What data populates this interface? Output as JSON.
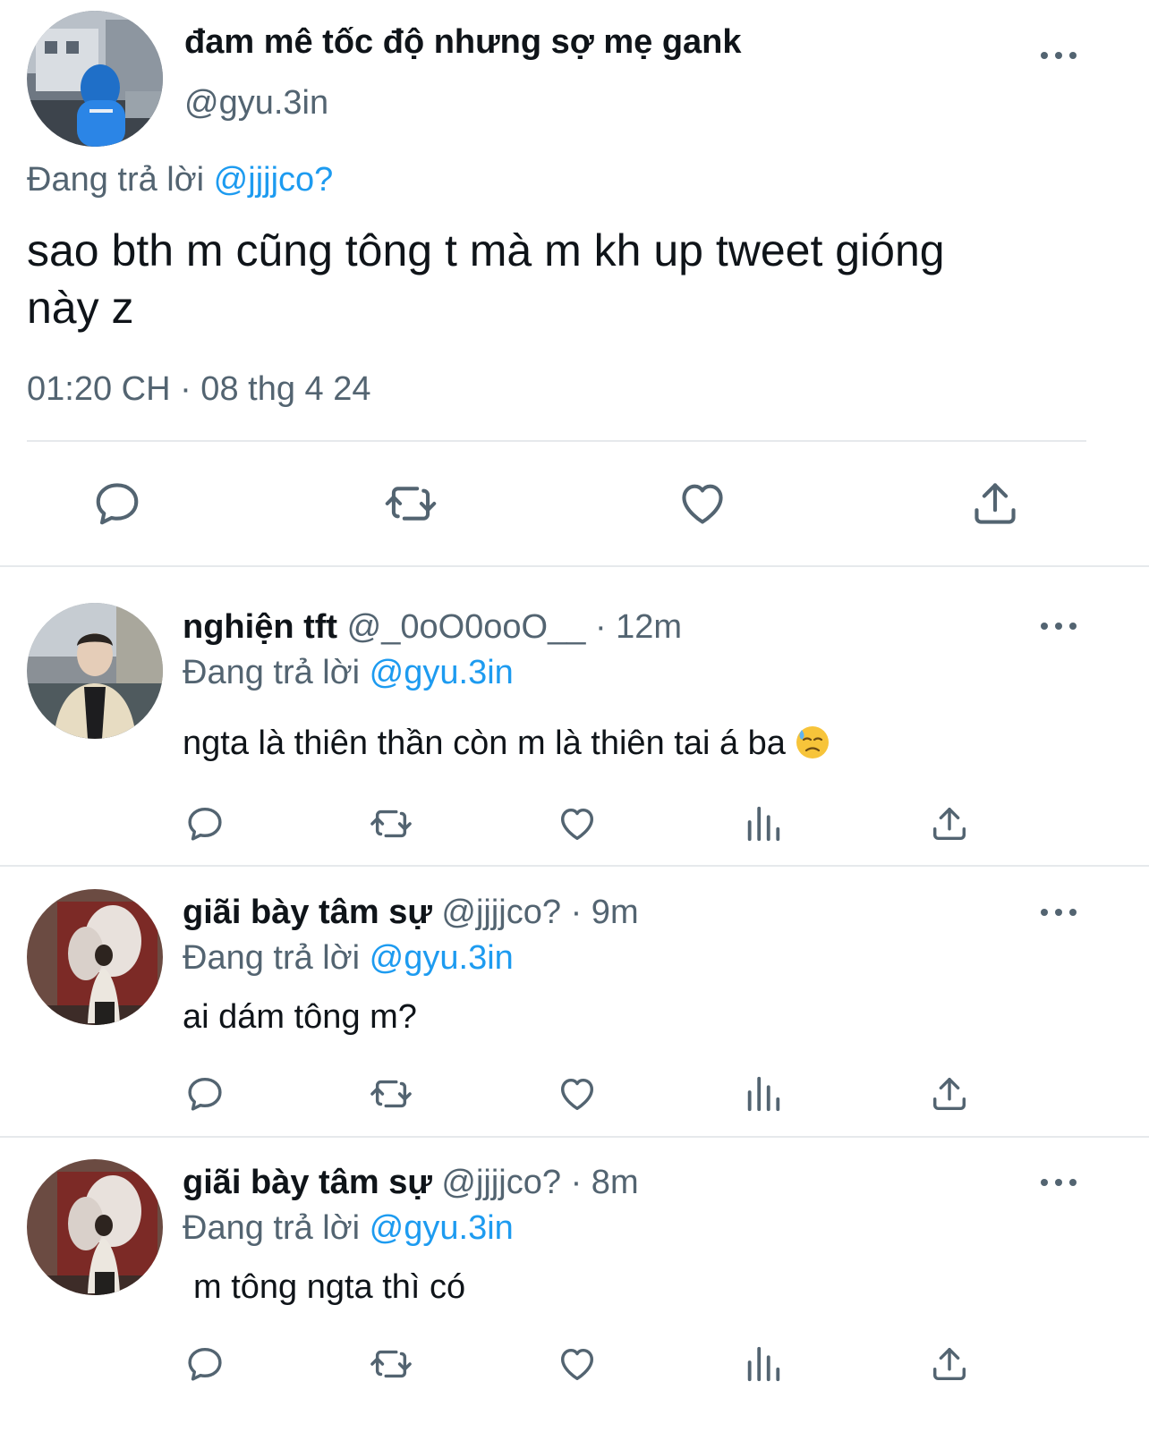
{
  "main_tweet": {
    "display_name": "đam mê tốc độ nhưng sợ mẹ gank",
    "handle": "@gyu.3in",
    "reply_prefix": "Đang trả lời",
    "reply_to": "@jjjjco?",
    "text_line1": "sao bth m cũng tông t mà m kh up tweet gióng",
    "text_line2": "này z",
    "timestamp": "01:20 CH · 08 thg 4 24",
    "actions": [
      "reply-icon",
      "retweet-icon",
      "like-icon",
      "share-icon"
    ]
  },
  "replies": [
    {
      "display_name": "nghiện tft",
      "handle": "@_0oO0ooO__",
      "time": "· 12m",
      "reply_prefix": "Đang trả lời",
      "reply_to": "@gyu.3in",
      "text": "ngta là thiên thần còn m là thiên tai á ba",
      "emoji": "downcast-face-with-sweat-icon"
    },
    {
      "display_name": "giãi bày tâm sự",
      "handle": "@jjjjco?",
      "time": "· 9m",
      "reply_prefix": "Đang trả lời",
      "reply_to": "@gyu.3in",
      "text": "ai dám tông m?"
    },
    {
      "display_name": "giãi bày tâm sự",
      "handle": "@jjjjco?",
      "time": "· 8m",
      "reply_prefix": "Đang trả lời",
      "reply_to": "@gyu.3in",
      "text": "m tông ngta thì có"
    }
  ],
  "colors": {
    "link_blue": "#1d9bf0",
    "secondary_grey": "#536471",
    "text_black": "#0f1419",
    "divider": "#e6e9ec"
  }
}
